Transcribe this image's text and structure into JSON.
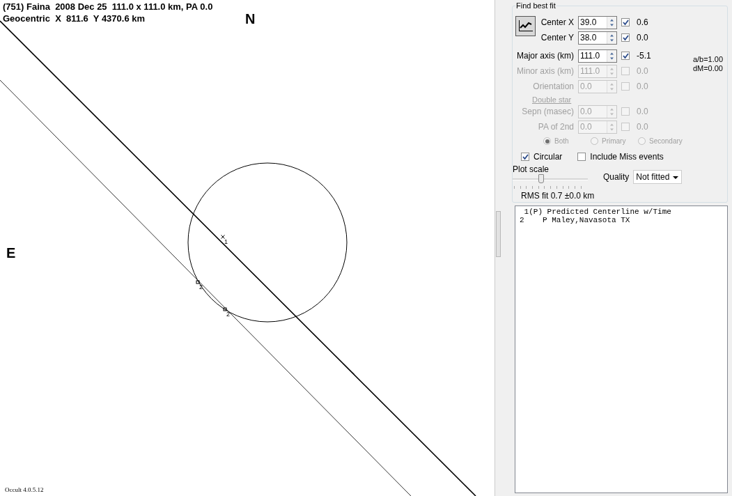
{
  "plot": {
    "title": "(751) Faina  2008 Dec 25  111.0 x 111.0 km, PA 0.0",
    "subtitle": "Geocentric  X  811.6  Y 4370.6 km",
    "north_label": "N",
    "east_label": "E",
    "points": [
      {
        "label": "1",
        "kind": "star"
      },
      {
        "label": "2",
        "kind": "square"
      },
      {
        "label": "2",
        "kind": "square"
      }
    ],
    "version": "Occult 4.0.5.12"
  },
  "fit_panel": {
    "title": "Find best fit",
    "params": [
      {
        "label": "Center X",
        "value": "39.0",
        "checked": true,
        "result": "0.6",
        "disabled": false
      },
      {
        "label": "Center Y",
        "value": "38.0",
        "checked": true,
        "result": "0.0",
        "disabled": false
      },
      {
        "label": "Major axis (km)",
        "value": "111.0",
        "checked": true,
        "result": "-5.1",
        "disabled": false
      },
      {
        "label": "Minor axis (km)",
        "value": "111.0",
        "checked": false,
        "result": "0.0",
        "disabled": true
      },
      {
        "label": "Orientation",
        "value": "0.0",
        "checked": false,
        "result": "0.0",
        "disabled": true
      }
    ],
    "ratio": "a/b=1.00",
    "dm": "dM=0.00",
    "double_star": {
      "title": "Double star",
      "params": [
        {
          "label": "Sepn (masec)",
          "value": "0.0",
          "checked": false,
          "result": "0.0",
          "disabled": true
        },
        {
          "label": "PA of 2nd",
          "value": "0.0",
          "checked": false,
          "result": "0.0",
          "disabled": true
        }
      ],
      "radios": [
        {
          "label": "Both",
          "selected": true
        },
        {
          "label": "Primary",
          "selected": false
        },
        {
          "label": "Secondary",
          "selected": false
        }
      ]
    },
    "options": [
      {
        "label": "Circular",
        "checked": true
      },
      {
        "label": "Include Miss events",
        "checked": false
      }
    ],
    "plot_scale": {
      "label": "Plot scale",
      "level": 0.38
    },
    "quality": {
      "label": "Quality",
      "value": "Not fitted"
    },
    "rms": "RMS fit 0.7 ±0.0 km",
    "events": [
      " 1(P) Predicted Centerline w/Time",
      "2    P Maley,Navasota TX"
    ]
  }
}
